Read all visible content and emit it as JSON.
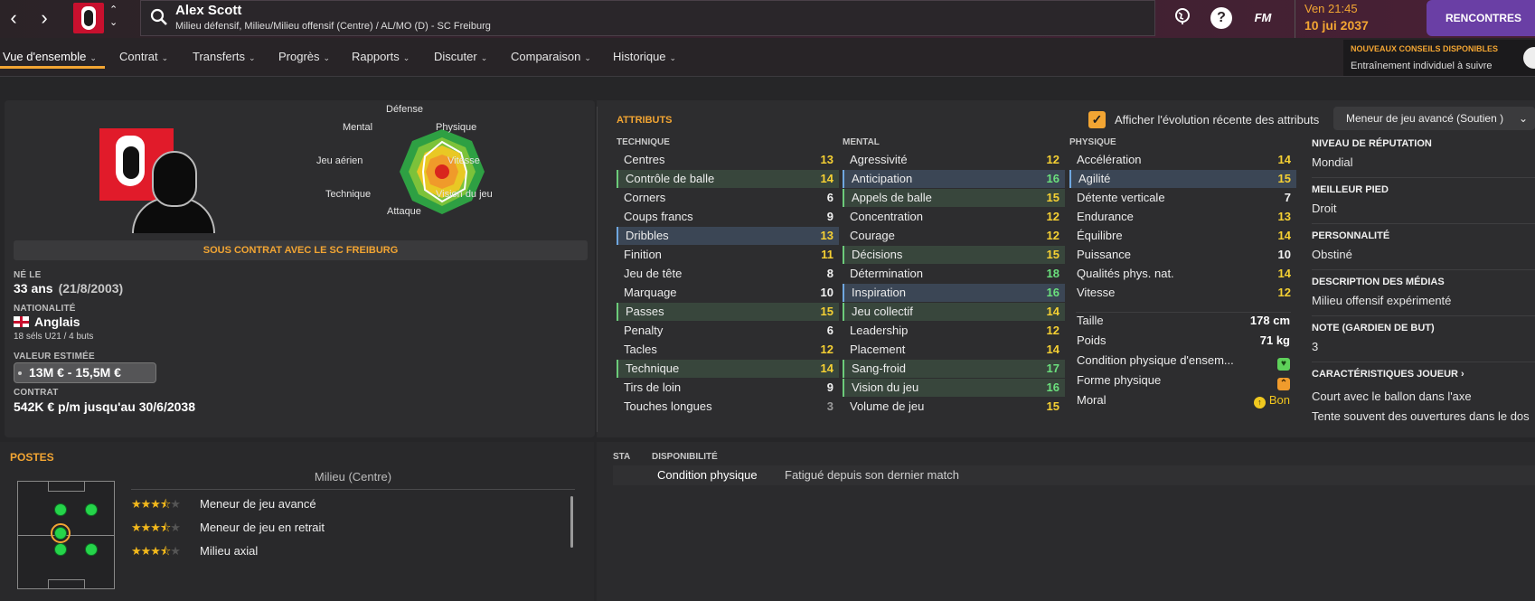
{
  "header": {
    "back": "‹",
    "forward": "›",
    "player_name": "Alex Scott",
    "player_positions": "Milieu défensif, Milieu/Milieu offensif (Centre) / AL/MO (D) - SC Freiburg",
    "fm_label": "FM",
    "help_label": "?",
    "time": "Ven 21:45",
    "date": "10 jui 2037",
    "continue_label": "RENCONTRES"
  },
  "tabs": [
    {
      "label": "Vue d'ensemble"
    },
    {
      "label": "Contrat"
    },
    {
      "label": "Transferts"
    },
    {
      "label": "Progrès"
    },
    {
      "label": "Rapports"
    },
    {
      "label": "Discuter"
    },
    {
      "label": "Comparaison"
    },
    {
      "label": "Historique"
    }
  ],
  "advice": {
    "title": "NOUVEAUX CONSEILS DISPONIBLES",
    "text": "Entraînement individuel à suivre"
  },
  "radar": {
    "labels": {
      "defense": "Défense",
      "physique": "Physique",
      "vitesse": "Vitesse",
      "vision": "Vision du jeu",
      "attaque": "Attaque",
      "technique": "Technique",
      "jeu_aerien": "Jeu aérien",
      "mental": "Mental"
    }
  },
  "profile": {
    "contract_banner": "SOUS CONTRAT AVEC LE SC FREIBURG",
    "born_label": "NÉ LE",
    "age": "33 ans",
    "birth_date": "(21/8/2003)",
    "nationality_label": "NATIONALITÉ",
    "nationality": "Anglais",
    "caps": "18 séls U21 / 4 buts",
    "value_label": "VALEUR ESTIMÉE",
    "value": "13M € - 15,5M €",
    "contract_label": "CONTRAT",
    "contract": "542K € p/m jusqu'au 30/6/2038"
  },
  "attributes": {
    "title": "ATTRIBUTS",
    "show_evolution_label": "Afficher l'évolution récente des attributs",
    "show_evolution_checked": true,
    "role": "Meneur de jeu avancé (Soutien )",
    "technique_header": "TECHNIQUE",
    "mental_header": "MENTAL",
    "physique_header": "PHYSIQUE",
    "technique": [
      {
        "name": "Centres",
        "value": "13",
        "tone": "yel",
        "hl": ""
      },
      {
        "name": "Contrôle de balle",
        "value": "14",
        "tone": "yel",
        "hl": "green"
      },
      {
        "name": "Corners",
        "value": "6",
        "tone": "wht",
        "hl": ""
      },
      {
        "name": "Coups francs",
        "value": "9",
        "tone": "wht",
        "hl": ""
      },
      {
        "name": "Dribbles",
        "value": "13",
        "tone": "yel",
        "hl": "blue"
      },
      {
        "name": "Finition",
        "value": "11",
        "tone": "yel",
        "hl": ""
      },
      {
        "name": "Jeu de tête",
        "value": "8",
        "tone": "wht",
        "hl": ""
      },
      {
        "name": "Marquage",
        "value": "10",
        "tone": "wht",
        "hl": ""
      },
      {
        "name": "Passes",
        "value": "15",
        "tone": "yel",
        "hl": "green"
      },
      {
        "name": "Penalty",
        "value": "6",
        "tone": "wht",
        "hl": ""
      },
      {
        "name": "Tacles",
        "value": "12",
        "tone": "yel",
        "hl": ""
      },
      {
        "name": "Technique",
        "value": "14",
        "tone": "yel",
        "hl": "green"
      },
      {
        "name": "Tirs de loin",
        "value": "9",
        "tone": "wht",
        "hl": ""
      },
      {
        "name": "Touches longues",
        "value": "3",
        "tone": "gry",
        "hl": ""
      }
    ],
    "mental": [
      {
        "name": "Agressivité",
        "value": "12",
        "tone": "yel",
        "hl": ""
      },
      {
        "name": "Anticipation",
        "value": "16",
        "tone": "grn",
        "hl": "blue"
      },
      {
        "name": "Appels de balle",
        "value": "15",
        "tone": "yel",
        "hl": "green"
      },
      {
        "name": "Concentration",
        "value": "12",
        "tone": "yel",
        "hl": ""
      },
      {
        "name": "Courage",
        "value": "12",
        "tone": "yel",
        "hl": ""
      },
      {
        "name": "Décisions",
        "value": "15",
        "tone": "yel",
        "hl": "green"
      },
      {
        "name": "Détermination",
        "value": "18",
        "tone": "grn",
        "hl": ""
      },
      {
        "name": "Inspiration",
        "value": "16",
        "tone": "grn",
        "hl": "blue"
      },
      {
        "name": "Jeu collectif",
        "value": "14",
        "tone": "yel",
        "hl": "green"
      },
      {
        "name": "Leadership",
        "value": "12",
        "tone": "yel",
        "hl": ""
      },
      {
        "name": "Placement",
        "value": "14",
        "tone": "yel",
        "hl": ""
      },
      {
        "name": "Sang-froid",
        "value": "17",
        "tone": "grn",
        "hl": "green"
      },
      {
        "name": "Vision du jeu",
        "value": "16",
        "tone": "grn",
        "hl": "green"
      },
      {
        "name": "Volume de jeu",
        "value": "15",
        "tone": "yel",
        "hl": ""
      }
    ],
    "physique": [
      {
        "name": "Accélération",
        "value": "14",
        "tone": "yel",
        "hl": ""
      },
      {
        "name": "Agilité",
        "value": "15",
        "tone": "yel",
        "hl": "blue"
      },
      {
        "name": "Détente verticale",
        "value": "7",
        "tone": "wht",
        "hl": ""
      },
      {
        "name": "Endurance",
        "value": "13",
        "tone": "yel",
        "hl": ""
      },
      {
        "name": "Équilibre",
        "value": "14",
        "tone": "yel",
        "hl": ""
      },
      {
        "name": "Puissance",
        "value": "10",
        "tone": "wht",
        "hl": ""
      },
      {
        "name": "Qualités phys. nat.",
        "value": "14",
        "tone": "yel",
        "hl": ""
      },
      {
        "name": "Vitesse",
        "value": "12",
        "tone": "yel",
        "hl": ""
      }
    ],
    "body": {
      "height_label": "Taille",
      "height": "178 cm",
      "weight_label": "Poids",
      "weight": "71 kg",
      "condition_label": "Condition physique d'ensem...",
      "form_label": "Forme physique",
      "morale_label": "Moral",
      "morale": "Bon"
    }
  },
  "info": {
    "reputation_label": "NIVEAU DE RÉPUTATION",
    "reputation": "Mondial",
    "foot_label": "MEILLEUR PIED",
    "foot": "Droit",
    "personality_label": "PERSONNALITÉ",
    "personality": "Obstiné",
    "media_label": "DESCRIPTION DES MÉDIAS",
    "media": "Milieu offensif expérimenté",
    "gk_label": "NOTE (GARDIEN DE BUT)",
    "gk": "3",
    "traits_label": "CARACTÉRISTIQUES JOUEUR ›",
    "trait1": "Court avec le ballon dans l'axe",
    "trait2": "Tente souvent des ouvertures dans le dos"
  },
  "postes": {
    "title": "POSTES",
    "subtitle": "Milieu (Centre)",
    "roles": [
      {
        "name": "Meneur de jeu avancé",
        "stars": 3.5
      },
      {
        "name": "Meneur de jeu en retrait",
        "stars": 3.5
      },
      {
        "name": "Milieu axial",
        "stars": 3.5
      }
    ]
  },
  "sta": {
    "col1": "STA",
    "col2": "DISPONIBILITÉ",
    "condition": "Condition physique",
    "status": "Fatigué depuis son dernier match"
  },
  "colors": {
    "accent": "#f2a533",
    "highlight_green": "#6ccb7a",
    "highlight_blue": "#6fa7e0",
    "value_yellow": "#f5d033",
    "value_green": "#6be07d",
    "continue_button": "#6a3fa5"
  }
}
